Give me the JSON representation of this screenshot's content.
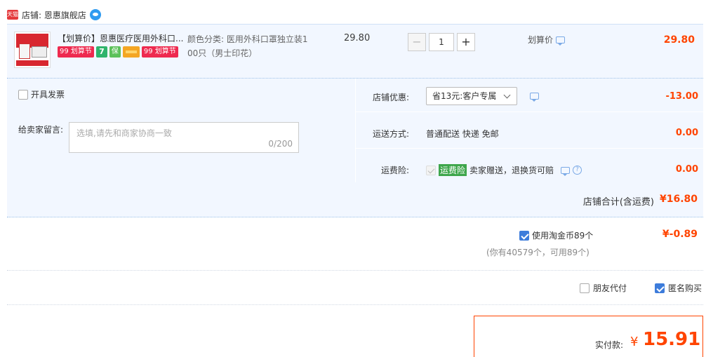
{
  "shop": {
    "badge_text": "天猫",
    "label": "店铺: 恩惠旗舰店"
  },
  "item": {
    "title": "【划算价】恩惠医疗医用外科口...",
    "badge_99_a": "99 划算节",
    "badge_7": "7",
    "badge_shield": "保",
    "badge_99_b": "99 划算节",
    "sku_line1": "颜色分类: 医用外科口罩独立装1",
    "sku_line2": "00只（男士印花）",
    "unit_price": "29.80",
    "qty_minus": "−",
    "qty_value": "1",
    "qty_plus": "+",
    "price_tag": "划算价",
    "row_total": "29.80"
  },
  "options": {
    "invoice_label": "开具发票",
    "message_label": "给卖家留言:",
    "message_placeholder": "选填,请先和商家协商一致",
    "message_count": "0/200",
    "discount_label": "店铺优惠:",
    "discount_value": "省13元:客户专属",
    "discount_amount": "-13.00",
    "delivery_label": "运送方式:",
    "delivery_value": "普通配送 快递 免邮",
    "delivery_amount": "0.00",
    "insurance_label": "运费险:",
    "insurance_tag": "运费险",
    "insurance_value": "卖家赠送，退换货可赔",
    "insurance_amount": "0.00",
    "help_icon": "?"
  },
  "shop_total": {
    "label": "店铺合计(含运费)",
    "value": "¥16.80"
  },
  "coins": {
    "label": "使用淘金币89个",
    "value": "¥-0.89",
    "hint": "(你有40579个，可用89个)"
  },
  "extras": {
    "friend_pay": "朋友代付",
    "anonymous": "匿名购买"
  },
  "payment": {
    "label": "实付款:",
    "currency": "¥",
    "amount": "15.91"
  },
  "colors": {
    "accent": "#ff4400",
    "checkbox_blue": "#3d7cdb",
    "row_bg": "#f2f7ff"
  }
}
